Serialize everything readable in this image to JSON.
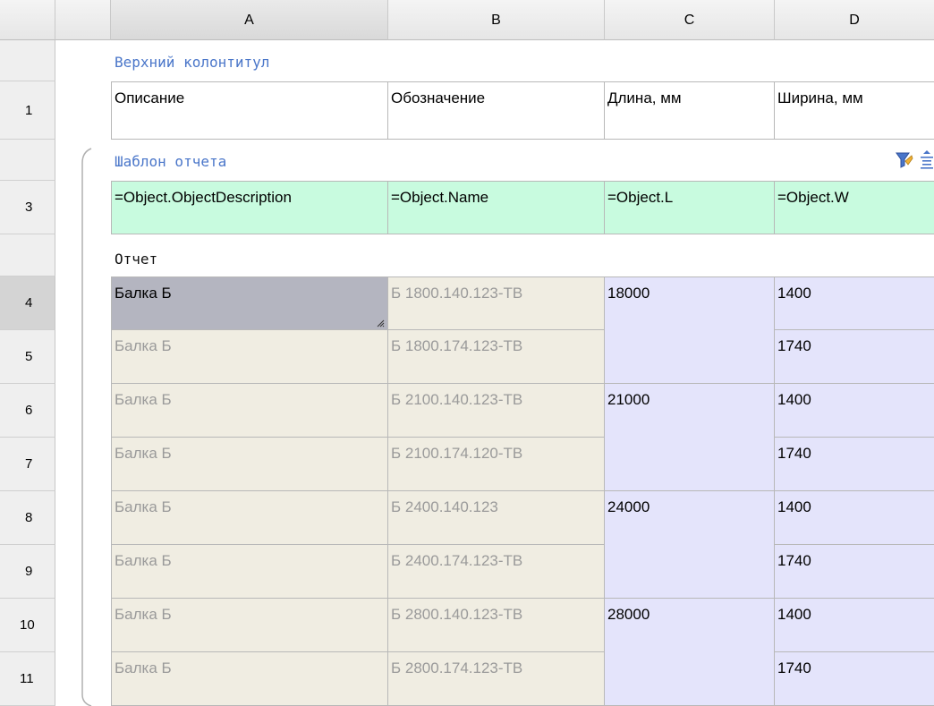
{
  "columns": [
    "A",
    "B",
    "C",
    "D"
  ],
  "sections": {
    "header": "Верхний колонтитул",
    "template": "Шаблон отчета",
    "report": "Отчет"
  },
  "header_row": {
    "row": "1",
    "cells": [
      "Описание",
      "Обозначение",
      "Длина, мм",
      "Ширина, мм"
    ]
  },
  "template_row": {
    "row": "3",
    "cells": [
      "=Object.ObjectDescription",
      "=Object.Name",
      "=Object.L",
      "=Object.W"
    ]
  },
  "report_rows": [
    {
      "row": "4",
      "desc": "Балка Б",
      "name": "Б 1800.140.123-ТВ",
      "width": "1400"
    },
    {
      "row": "5",
      "desc": "Балка Б",
      "name": "Б 1800.174.123-ТВ",
      "width": "1740"
    },
    {
      "row": "6",
      "desc": "Балка Б",
      "name": "Б 2100.140.123-ТВ",
      "width": "1400"
    },
    {
      "row": "7",
      "desc": "Балка Б",
      "name": "Б 2100.174.120-ТВ",
      "width": "1740"
    },
    {
      "row": "8",
      "desc": "Балка Б",
      "name": "Б 2400.140.123",
      "width": "1400"
    },
    {
      "row": "9",
      "desc": "Балка Б",
      "name": "Б 2400.174.123-ТВ",
      "width": "1740"
    },
    {
      "row": "10",
      "desc": "Балка Б",
      "name": "Б 2800.140.123-ТВ",
      "width": "1400"
    },
    {
      "row": "11",
      "desc": "Балка Б",
      "name": "Б 2800.174.123-ТВ",
      "width": "1740"
    }
  ],
  "lengths": [
    "18000",
    "21000",
    "24000",
    "28000"
  ],
  "icons": [
    "filter-icon",
    "group-icon"
  ],
  "colors": {
    "template": "#c8fbdf",
    "beige": "#f0ede2",
    "lavender": "#e4e4fb",
    "section": "#4a76c9",
    "selected": "#b4b5c0"
  }
}
